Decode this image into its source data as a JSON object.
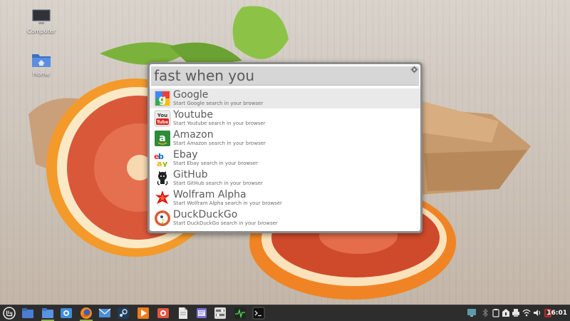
{
  "desktop": {
    "icons": [
      {
        "label": "Computer",
        "icon": "monitor-icon"
      },
      {
        "label": "Home",
        "icon": "home-folder-icon"
      }
    ]
  },
  "launcher": {
    "query": "fast when you",
    "results": [
      {
        "title": "Google",
        "subtitle": "Start Google search in your browser",
        "icon": "google-icon",
        "selected": true
      },
      {
        "title": "Youtube",
        "subtitle": "Start Youtube search in your browser",
        "icon": "youtube-icon"
      },
      {
        "title": "Amazon",
        "subtitle": "Start Amazon search in your browser",
        "icon": "amazon-icon"
      },
      {
        "title": "Ebay",
        "subtitle": "Start Ebay search in your browser",
        "icon": "ebay-icon"
      },
      {
        "title": "GitHub",
        "subtitle": "Start GitHub search in your browser",
        "icon": "github-icon"
      },
      {
        "title": "Wolfram Alpha",
        "subtitle": "Start Wolfram Alpha search in your browser",
        "icon": "wolfram-alpha-icon"
      },
      {
        "title": "DuckDuckGo",
        "subtitle": "Start DuckDuckGo search in your browser",
        "icon": "duckduckgo-icon"
      }
    ]
  },
  "taskbar": {
    "apps": [
      "mint-menu-icon",
      "show-desktop-icon",
      "files-icon",
      "screenshot-icon",
      "firefox-icon",
      "mail-icon",
      "steam-icon",
      "media-player-icon",
      "image-viewer-icon",
      "document-icon",
      "text-editor-icon",
      "system-settings-icon",
      "system-monitor-icon",
      "terminal-icon"
    ],
    "tray": [
      "display-icon",
      "bluetooth-icon",
      "clipboard-icon",
      "update-icon",
      "printer-icon",
      "wifi-icon",
      "volume-icon",
      "battery-icon"
    ],
    "clock": "16:01"
  },
  "colors": {
    "accent": "#8fb04c",
    "taskbar": "#2d2d2d",
    "launcher_border": "#8c8c8c"
  }
}
